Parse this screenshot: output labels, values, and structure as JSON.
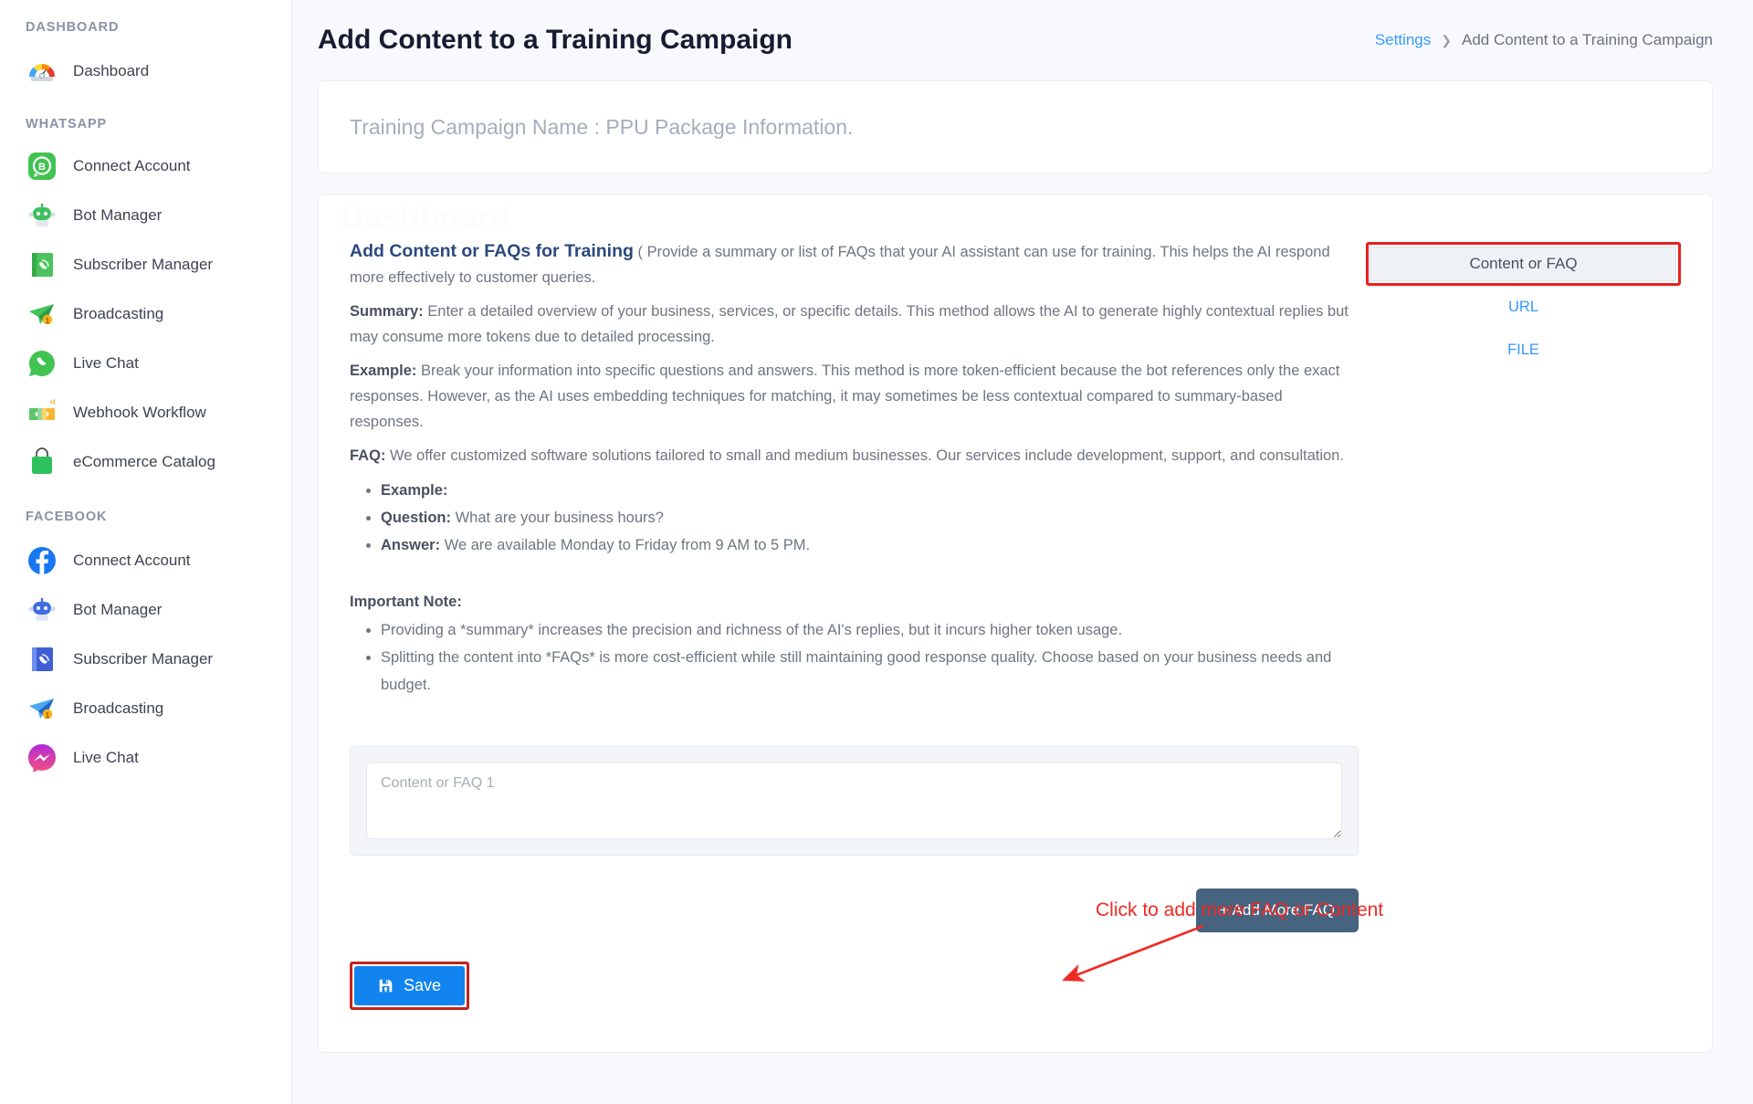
{
  "sidebar": {
    "sections": [
      {
        "label": "DASHBOARD",
        "items": [
          {
            "label": "Dashboard",
            "icon": "gauge-icon"
          }
        ]
      },
      {
        "label": "WHATSAPP",
        "items": [
          {
            "label": "Connect Account",
            "icon": "whatsapp-business-icon"
          },
          {
            "label": "Bot Manager",
            "icon": "robot-green-icon"
          },
          {
            "label": "Subscriber Manager",
            "icon": "contact-book-green-icon"
          },
          {
            "label": "Broadcasting",
            "icon": "paper-plane-green-icon"
          },
          {
            "label": "Live Chat",
            "icon": "whatsapp-icon"
          },
          {
            "label": "Webhook Workflow",
            "icon": "puzzle-handshake-icon"
          },
          {
            "label": "eCommerce Catalog",
            "icon": "shopping-bag-green-icon"
          }
        ]
      },
      {
        "label": "FACEBOOK",
        "items": [
          {
            "label": "Connect Account",
            "icon": "facebook-icon"
          },
          {
            "label": "Bot Manager",
            "icon": "robot-blue-icon"
          },
          {
            "label": "Subscriber Manager",
            "icon": "contact-book-blue-icon"
          },
          {
            "label": "Broadcasting",
            "icon": "paper-plane-blue-icon"
          },
          {
            "label": "Live Chat",
            "icon": "messenger-icon"
          }
        ]
      }
    ]
  },
  "header": {
    "title": "Add Content to a Training Campaign",
    "breadcrumb": {
      "root": "Settings",
      "separator": "❯",
      "current": "Add Content to a Training Campaign"
    }
  },
  "campaign": {
    "name_line": "Training Campaign Name : PPU Package Information."
  },
  "content": {
    "watermark": "Dashboard",
    "heading": "Add Content or FAQs for Training",
    "heading_tail": " ( Provide a summary or list of FAQs that your AI assistant can use for training. This helps the AI respond more effectively to customer queries.",
    "summary_label": "Summary:",
    "summary_text": " Enter a detailed overview of your business, services, or specific details. This method allows the AI to generate highly contextual replies but may consume more tokens due to detailed processing.",
    "example_label": "Example:",
    "example_text": " Break your information into specific questions and answers. This method is more token-efficient because the bot references only the exact responses. However, as the AI uses embedding techniques for matching, it may sometimes be less contextual compared to summary-based responses.",
    "faq_label": "FAQ:",
    "faq_text": " We offer customized software solutions tailored to small and medium businesses. Our services include development, support, and consultation.",
    "faq_bullets": [
      {
        "label": "Example:",
        "text": ""
      },
      {
        "label": "Question:",
        "text": " What are your business hours?"
      },
      {
        "label": "Answer:",
        "text": " We are available Monday to Friday from 9 AM to 5 PM."
      }
    ],
    "note_title": "Important Note:",
    "note_bullets": [
      "Providing a *summary* increases the precision and richness of the AI's replies, but it incurs higher token usage.",
      "Splitting the content into *FAQs* is more cost-efficient while still maintaining good response quality. Choose based on your business needs and budget."
    ]
  },
  "tabs": {
    "active": "Content or FAQ",
    "links": [
      "URL",
      "FILE"
    ]
  },
  "form": {
    "textarea_placeholder": "Content or FAQ 1",
    "textarea_value": "",
    "add_more_label": "+ Add More FAQ",
    "save_label": "Save",
    "save_icon": "floppy-disk-icon"
  },
  "annotations": {
    "add_more_hint": "Click to add more FAQ or Content"
  },
  "colors": {
    "accent_blue": "#3699ff",
    "save_blue": "#1184f0",
    "annotation_red": "#ef2a23",
    "dark_button": "#46637f"
  }
}
